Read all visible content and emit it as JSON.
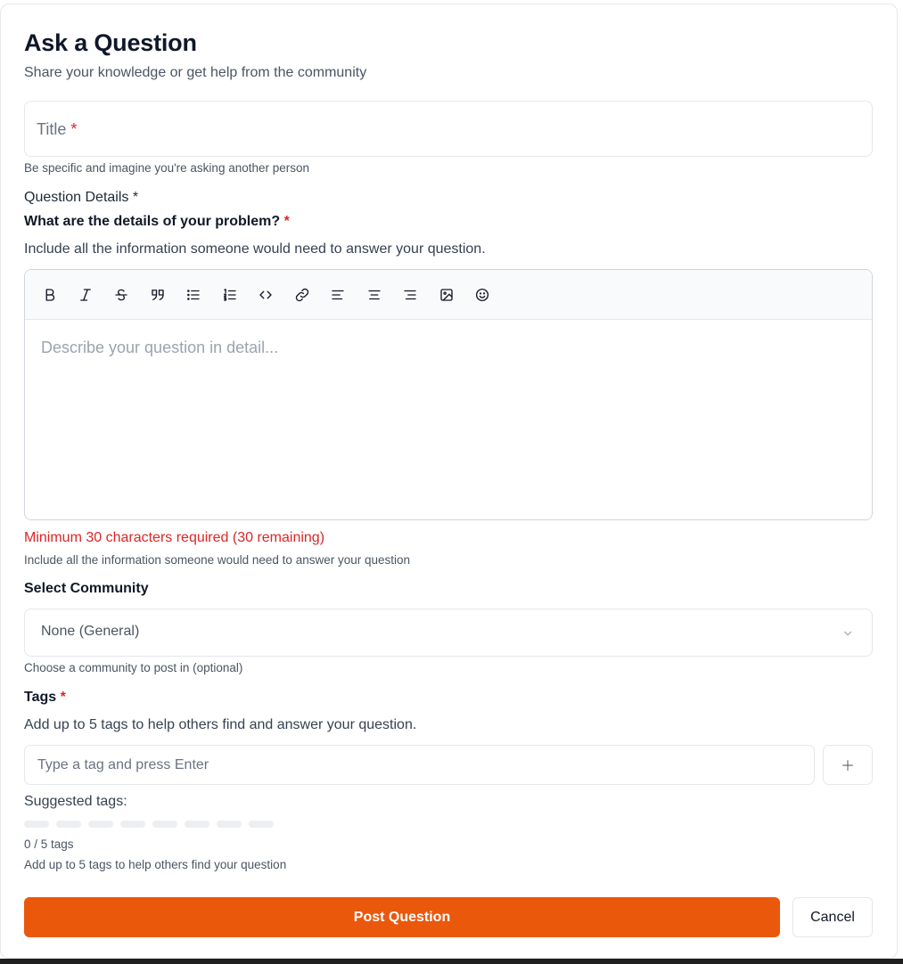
{
  "header": {
    "title": "Ask a Question",
    "subtitle": "Share your knowledge or get help from the community"
  },
  "title_field": {
    "placeholder": "Title",
    "required_mark": "*",
    "hint": "Be specific and imagine you're asking another person"
  },
  "details": {
    "section_label": "Question Details *",
    "question_label": "What are the details of your problem?",
    "required_mark": "*",
    "description": "Include all the information someone would need to answer your question.",
    "toolbar": [
      "bold-icon",
      "italic-icon",
      "strikethrough-icon",
      "quote-icon",
      "bullet-list-icon",
      "ordered-list-icon",
      "code-icon",
      "link-icon",
      "align-left-icon",
      "align-center-icon",
      "align-right-icon",
      "image-icon",
      "emoji-icon"
    ],
    "editor_placeholder": "Describe your question in detail...",
    "error": "Minimum 30 characters required (30 remaining)",
    "hint": "Include all the information someone would need to answer your question"
  },
  "community": {
    "label": "Select Community",
    "selected": "None (General)",
    "hint": "Choose a community to post in (optional)"
  },
  "tags": {
    "label": "Tags",
    "required_mark": "*",
    "description": "Add up to 5 tags to help others find and answer your question.",
    "input_placeholder": "Type a tag and press Enter",
    "suggested_label": "Suggested tags:",
    "count": "0 / 5 tags",
    "hint": "Add up to 5 tags to help others find your question"
  },
  "actions": {
    "post": "Post Question",
    "cancel": "Cancel"
  },
  "colors": {
    "accent": "#ea580c",
    "error": "#dc2626"
  }
}
